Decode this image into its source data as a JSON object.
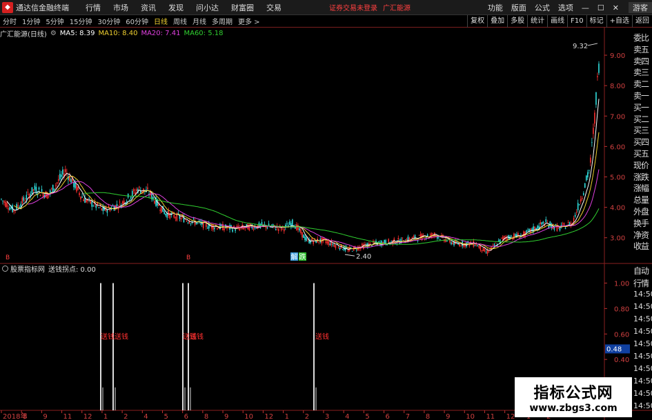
{
  "titlebar": {
    "app_title": "通达信金融终端",
    "menus": [
      "行情",
      "市场",
      "资讯",
      "发现",
      "问小达",
      "财富圈",
      "交易"
    ],
    "notice": "证券交易未登录",
    "stock_short": "广汇能源",
    "right_menus": [
      "功能",
      "版面",
      "公式",
      "选项"
    ],
    "guest": "游客"
  },
  "toolbar": {
    "periods": [
      "分时",
      "1分钟",
      "5分钟",
      "15分钟",
      "30分钟",
      "60分钟",
      "日线",
      "周线",
      "月线",
      "多周期",
      "更多 >"
    ],
    "active_period": "日线",
    "right_tools": [
      "复权",
      "叠加",
      "多股",
      "统计",
      "画线",
      "F10",
      "标记",
      "+自选",
      "返回"
    ]
  },
  "ma_header": {
    "stock": "广汇能源(日线)",
    "ma5": "MA5: 8.39",
    "ma10": "MA10: 8.40",
    "ma20": "MA20: 7.41",
    "ma60": "MA60: 5.18",
    "colors": {
      "ma5": "#ffffff",
      "ma10": "#f0d030",
      "ma20": "#e040e0",
      "ma60": "#30d030"
    }
  },
  "quote_panel": [
    "委比",
    "卖五",
    "卖四",
    "卖三",
    "卖二",
    "卖一",
    "买一",
    "买二",
    "买三",
    "买四",
    "买五",
    "现价",
    "涨跌",
    "涨幅",
    "总量",
    "外盘",
    "换手",
    "净资",
    "收益"
  ],
  "quote_panel2": {
    "labels": [
      "自动",
      "行情"
    ],
    "times": [
      "14:50",
      "14:50",
      "14:50",
      "14:50",
      "14:50",
      "14:50",
      "14:50",
      "14:50",
      "14:50",
      "14:50"
    ]
  },
  "indicator_header": {
    "name": "股票指标网",
    "value": "送钱拐点: 0.00"
  },
  "chart_data": {
    "type": "candlestick",
    "price_axis": {
      "ticks": [
        "9.00",
        "8.00",
        "7.00",
        "6.00",
        "5.00",
        "4.00",
        "3.00"
      ],
      "ylim": [
        2.2,
        9.5
      ]
    },
    "high_label": "9.32",
    "low_label": "2.40",
    "badges": [
      "解",
      "跌"
    ],
    "indicator_axis": {
      "ticks": [
        "1.00",
        "0.80",
        "0.60",
        "0.40"
      ],
      "current": "0.48",
      "ylim": [
        0,
        1.1
      ]
    },
    "signal_label": "送钱",
    "signal_texts": [
      "送钱送钱",
      "送钱",
      "送钱",
      "送钱"
    ],
    "time_axis": [
      "2018年",
      "8",
      "9",
      "11",
      "12",
      "1",
      "2",
      "4",
      "5",
      "6",
      "8",
      "9",
      "10",
      "12",
      "1",
      "2",
      "3",
      "4",
      "5",
      "6",
      "7",
      "8",
      "9",
      "10",
      "11",
      "12",
      "1",
      "2"
    ],
    "ma_colors": [
      "#ffffff",
      "#f0d030",
      "#e040e0",
      "#30d030"
    ]
  },
  "watermark": {
    "line1": "指标公式网",
    "line2": "www.zbgs3.com"
  }
}
